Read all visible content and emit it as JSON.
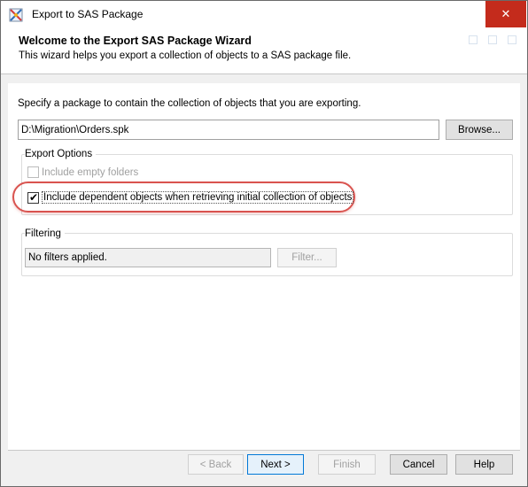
{
  "window": {
    "title": "Export to SAS Package",
    "close_glyph": "✕"
  },
  "banner": {
    "title": "Welcome to the Export SAS Package Wizard",
    "subtitle": "This wizard helps you export a collection of objects to a SAS package file."
  },
  "main": {
    "instruction": "Specify a package to contain the collection of objects that you are exporting.",
    "package_path": "D:\\Migration\\Orders.spk",
    "browse_label": "Browse..."
  },
  "export_options": {
    "label": "Export Options",
    "include_empty_folders": {
      "label": "Include empty folders",
      "checked": false,
      "enabled": false
    },
    "include_dependent": {
      "label": "Include dependent objects when retrieving initial collection of objects",
      "checked": true,
      "enabled": true
    }
  },
  "filtering": {
    "label": "Filtering",
    "status": "No filters applied.",
    "filter_button": "Filter..."
  },
  "footer": {
    "back": "< Back",
    "next": "Next >",
    "finish": "Finish",
    "cancel": "Cancel",
    "help": "Help"
  },
  "colors": {
    "highlight": "#d9534f",
    "close": "#c42b1c",
    "accent": "#0078d7"
  }
}
